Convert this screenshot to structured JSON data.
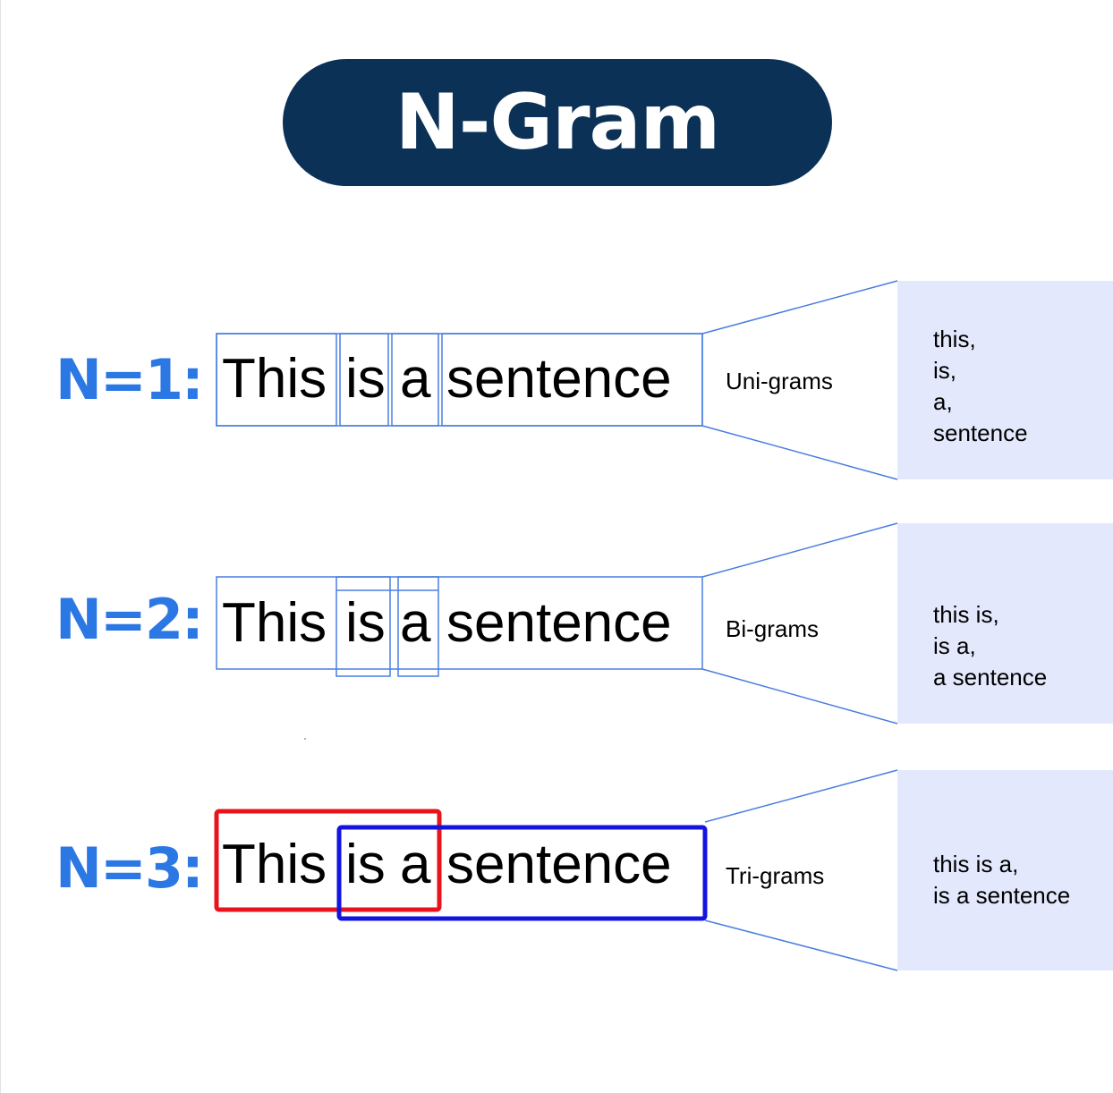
{
  "title": "N-Gram",
  "colors": {
    "title_bg": "#0c3157",
    "label": "#2b78e4",
    "box_line": "#4a7ee0",
    "panel": "#e3e8fc",
    "trigram_first": "#e8141c",
    "trigram_second": "#1414e0"
  },
  "sentence": [
    "This",
    "is",
    "a",
    "sentence"
  ],
  "rows": [
    {
      "label": "N=1:",
      "type": "Uni-grams",
      "results": [
        "this,",
        "is,",
        "a,",
        "sentence"
      ]
    },
    {
      "label": "N=2:",
      "type": "Bi-grams",
      "results": [
        "this is,",
        "is a,",
        "a sentence"
      ]
    },
    {
      "label": "N=3:",
      "type": "Tri-grams",
      "results": [
        "this is a,",
        "is a sentence"
      ]
    }
  ]
}
